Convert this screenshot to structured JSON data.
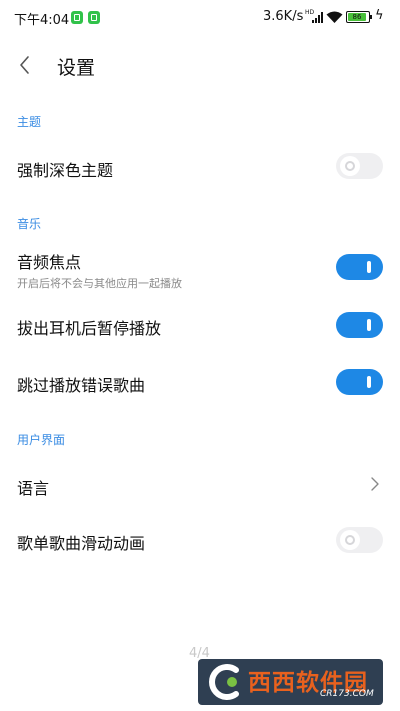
{
  "status_bar": {
    "time": "下午4:04",
    "network_speed": "3.6K/s",
    "network_type": "HD",
    "battery_level": "86",
    "battery_color": "#49c03a",
    "app_icon_color": "#31c24a"
  },
  "header": {
    "title": "设置",
    "back_icon": "chevron-left-icon"
  },
  "sections": {
    "theme": {
      "title": "主题",
      "force_dark": {
        "label": "强制深色主题",
        "enabled": false
      }
    },
    "music": {
      "title": "音乐",
      "audio_focus": {
        "label": "音频焦点",
        "subtitle": "开启后将不会与其他应用一起播放",
        "enabled": true
      },
      "pause_on_unplug": {
        "label": "拔出耳机后暂停播放",
        "enabled": true
      },
      "skip_error_songs": {
        "label": "跳过播放错误歌曲",
        "enabled": true
      }
    },
    "ui": {
      "title": "用户界面",
      "language": {
        "label": "语言",
        "icon": "chevron-right-icon"
      },
      "scroll_animation": {
        "label": "歌单歌曲滑动动画",
        "enabled": false
      }
    }
  },
  "page_indicator": "4/4",
  "watermark": {
    "brand": "西西软件园",
    "url": "CR173.COM"
  },
  "colors": {
    "accent": "#1e88e5",
    "section_title": "#3a8ce3",
    "toggle_off": "#efeff1"
  }
}
